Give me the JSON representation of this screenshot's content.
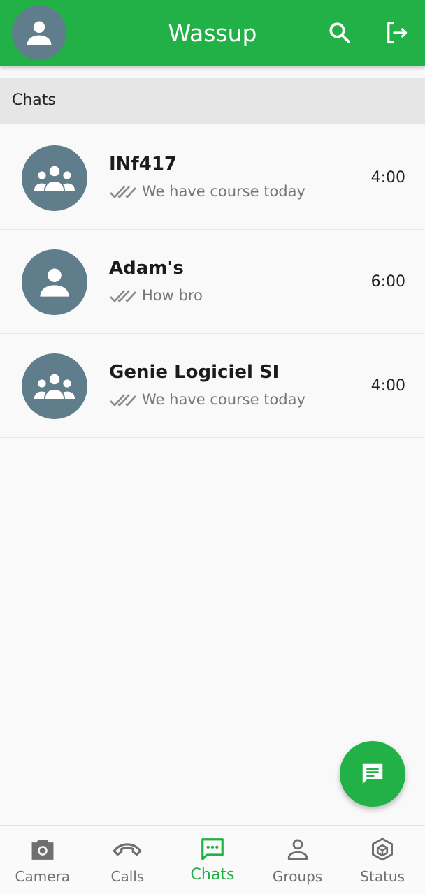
{
  "header": {
    "title": "Wassup",
    "avatar_icon": "person-icon",
    "search_icon": "search-icon",
    "logout_icon": "logout-icon",
    "bg_color": "#22b147"
  },
  "section": {
    "label": "Chats"
  },
  "chats": [
    {
      "name": "INf417",
      "message": "We have course today",
      "time": "4:00",
      "avatar_icon": "group-icon"
    },
    {
      "name": "Adam's",
      "message": "How bro",
      "time": "6:00",
      "avatar_icon": "person-icon"
    },
    {
      "name": "Genie Logiciel SI",
      "message": "We have course today",
      "time": "4:00",
      "avatar_icon": "group-icon"
    }
  ],
  "fab": {
    "icon": "message-icon"
  },
  "nav": [
    {
      "label": "Camera",
      "icon": "camera-icon",
      "active": false
    },
    {
      "label": "Calls",
      "icon": "phone-icon",
      "active": false
    },
    {
      "label": "Chats",
      "icon": "chat-icon",
      "active": true
    },
    {
      "label": "Groups",
      "icon": "person-outline-icon",
      "active": false
    },
    {
      "label": "Status",
      "icon": "status-hex-icon",
      "active": false
    }
  ],
  "colors": {
    "accent": "#22b147",
    "avatar_bg": "#607d8b",
    "inactive": "#6f6f6f"
  }
}
